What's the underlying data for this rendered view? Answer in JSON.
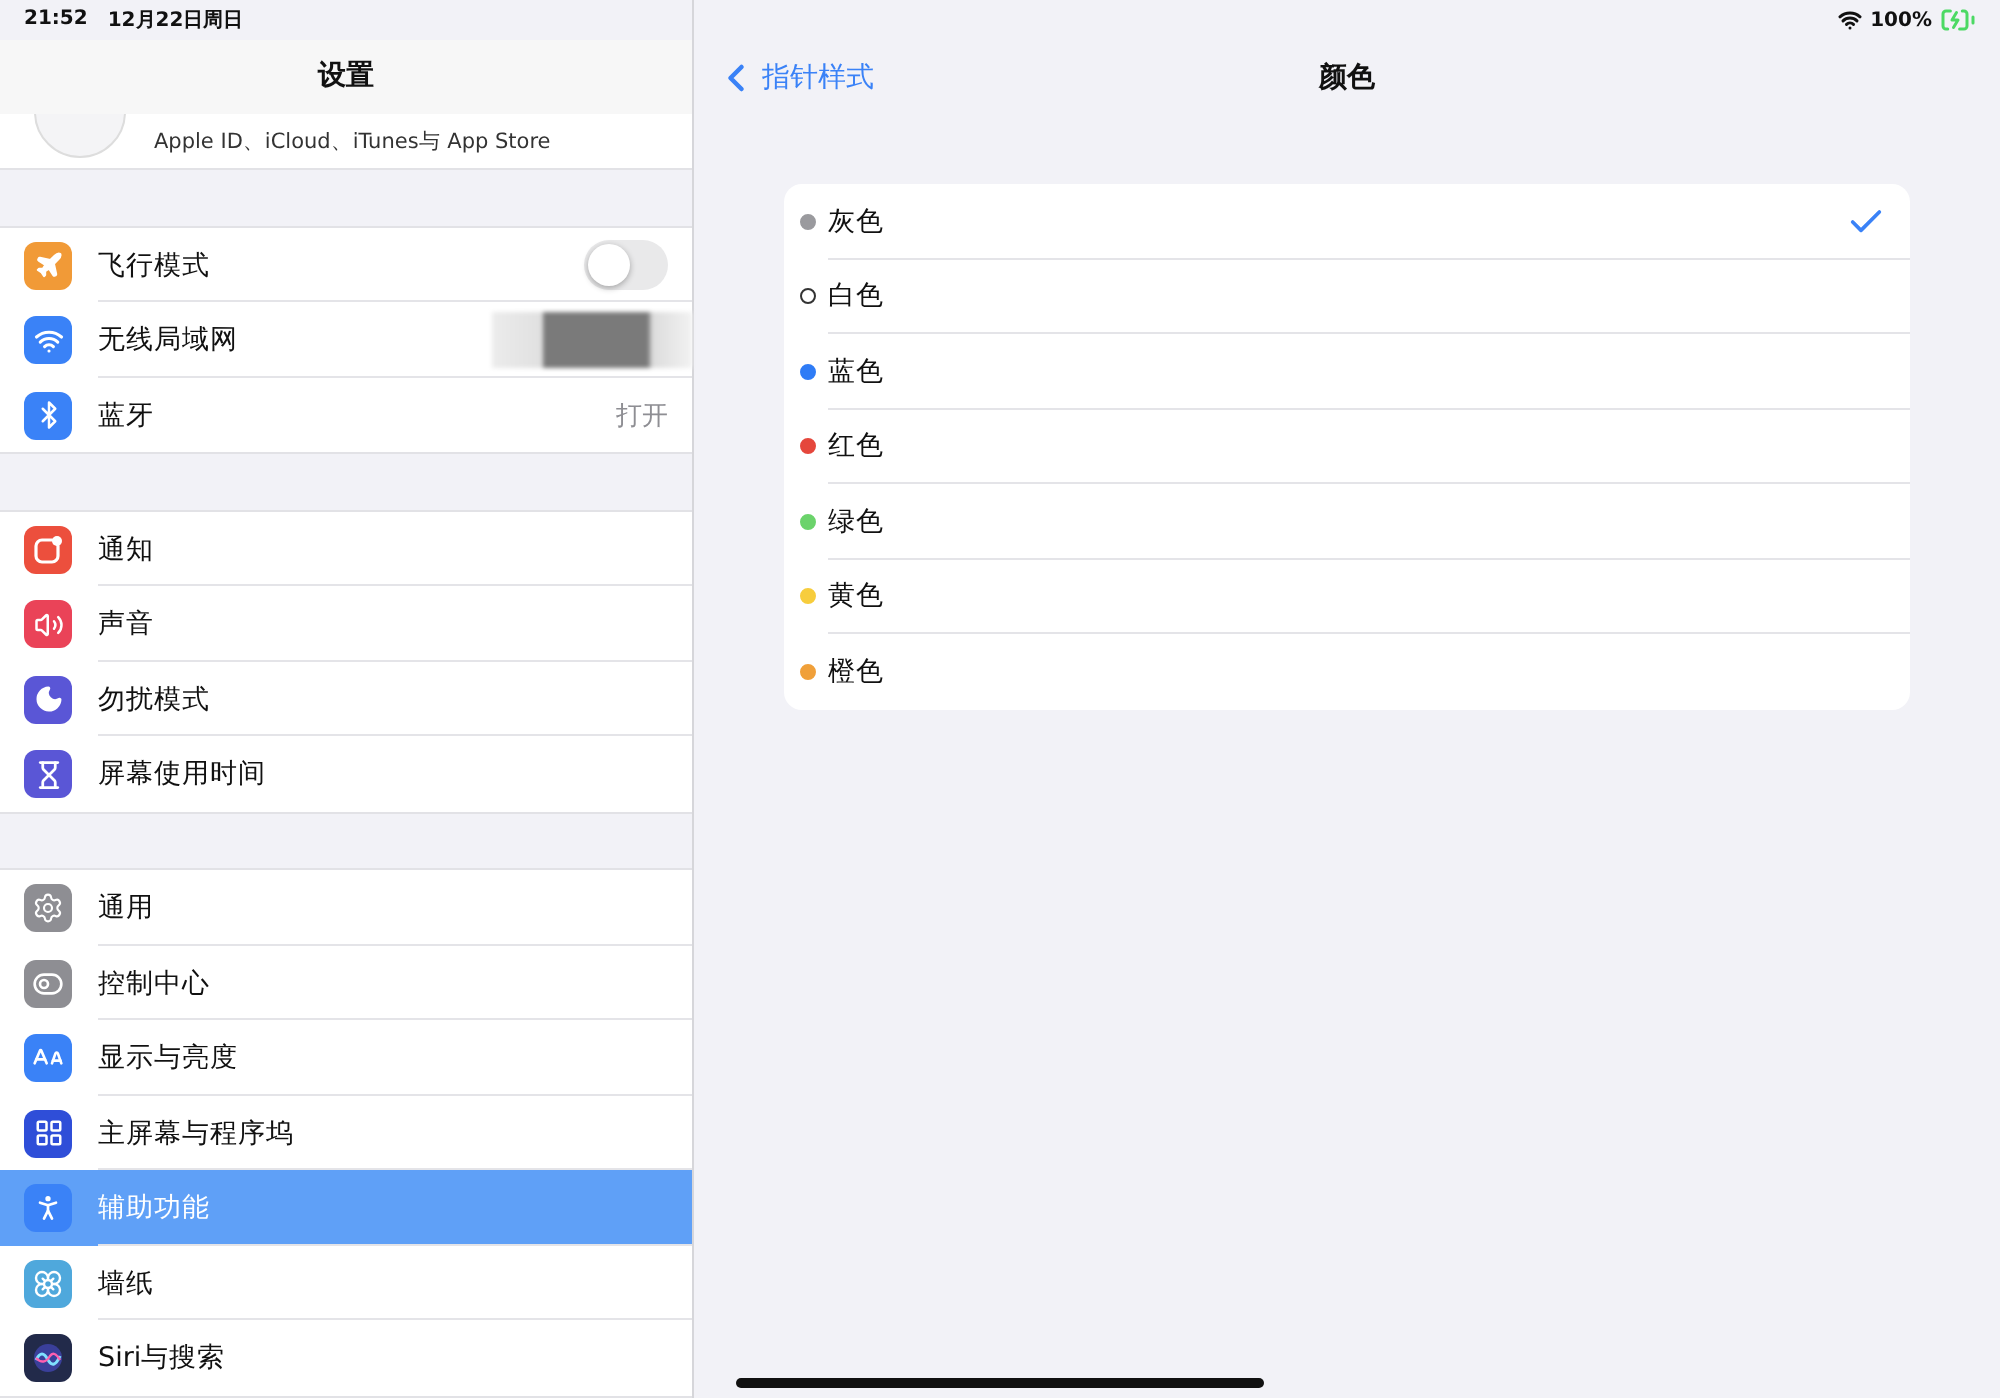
{
  "status_bar": {
    "time": "21:52",
    "date": "12月22日周日",
    "battery": "100%"
  },
  "sidebar": {
    "title": "设置",
    "account_subtitle": "Apple ID、iCloud、iTunes与 App Store",
    "groups": [
      [
        {
          "label": "飞行模式",
          "kind": "toggle",
          "on": false,
          "selected": false
        },
        {
          "label": "无线局域网",
          "kind": "blurred",
          "selected": false
        },
        {
          "label": "蓝牙",
          "kind": "value",
          "value": "打开",
          "selected": false
        }
      ],
      [
        {
          "label": "通知",
          "kind": "plain",
          "selected": false
        },
        {
          "label": "声音",
          "kind": "plain",
          "selected": false
        },
        {
          "label": "勿扰模式",
          "kind": "plain",
          "selected": false
        },
        {
          "label": "屏幕使用时间",
          "kind": "plain",
          "selected": false
        }
      ],
      [
        {
          "label": "通用",
          "kind": "plain",
          "selected": false
        },
        {
          "label": "控制中心",
          "kind": "plain",
          "selected": false
        },
        {
          "label": "显示与亮度",
          "kind": "plain",
          "selected": false
        },
        {
          "label": "主屏幕与程序坞",
          "kind": "plain",
          "selected": false
        },
        {
          "label": "辅助功能",
          "kind": "plain",
          "selected": true
        },
        {
          "label": "墙纸",
          "kind": "plain",
          "selected": false
        },
        {
          "label": "Siri与搜索",
          "kind": "plain",
          "selected": false
        }
      ]
    ]
  },
  "detail": {
    "back": "指针样式",
    "title": "颜色",
    "options": [
      {
        "label": "灰色",
        "color": "#9a9a9e",
        "selected": true
      },
      {
        "label": "白色",
        "color": "#ffffff",
        "selected": false
      },
      {
        "label": "蓝色",
        "color": "#2f7cf6",
        "selected": false
      },
      {
        "label": "红色",
        "color": "#e5473c",
        "selected": false
      },
      {
        "label": "绿色",
        "color": "#6bd36b",
        "selected": false
      },
      {
        "label": "黄色",
        "color": "#f7cd3d",
        "selected": false
      },
      {
        "label": "橙色",
        "color": "#f0a03a",
        "selected": false
      }
    ]
  }
}
